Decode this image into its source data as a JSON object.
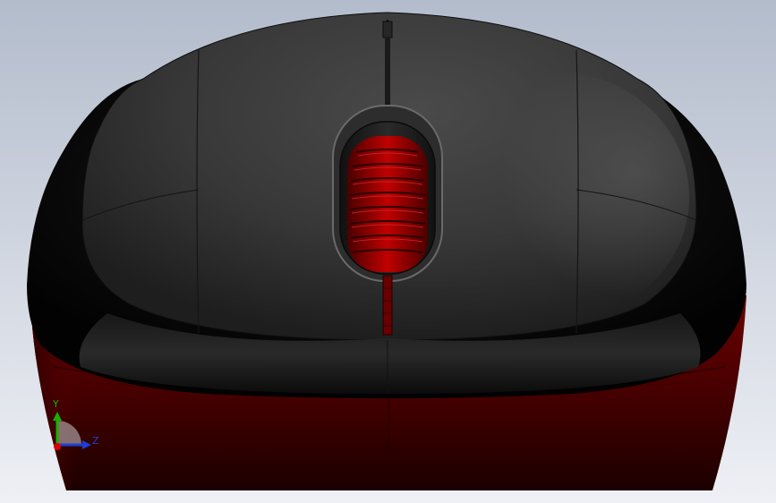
{
  "colors": {
    "background_top": "#b3bccc",
    "background_bottom": "#eef0f5",
    "shell_top": "#3a3a3a",
    "shell_dark": "#060606",
    "body_red": "#5a0000",
    "body_red_dark": "#1c0000",
    "wheel_red": "#b00000",
    "axis_y": "#15b000",
    "axis_z": "#1c3fd8",
    "axis_x": "#d80000"
  },
  "triad": {
    "y_label": "Y",
    "z_label": "Z"
  }
}
